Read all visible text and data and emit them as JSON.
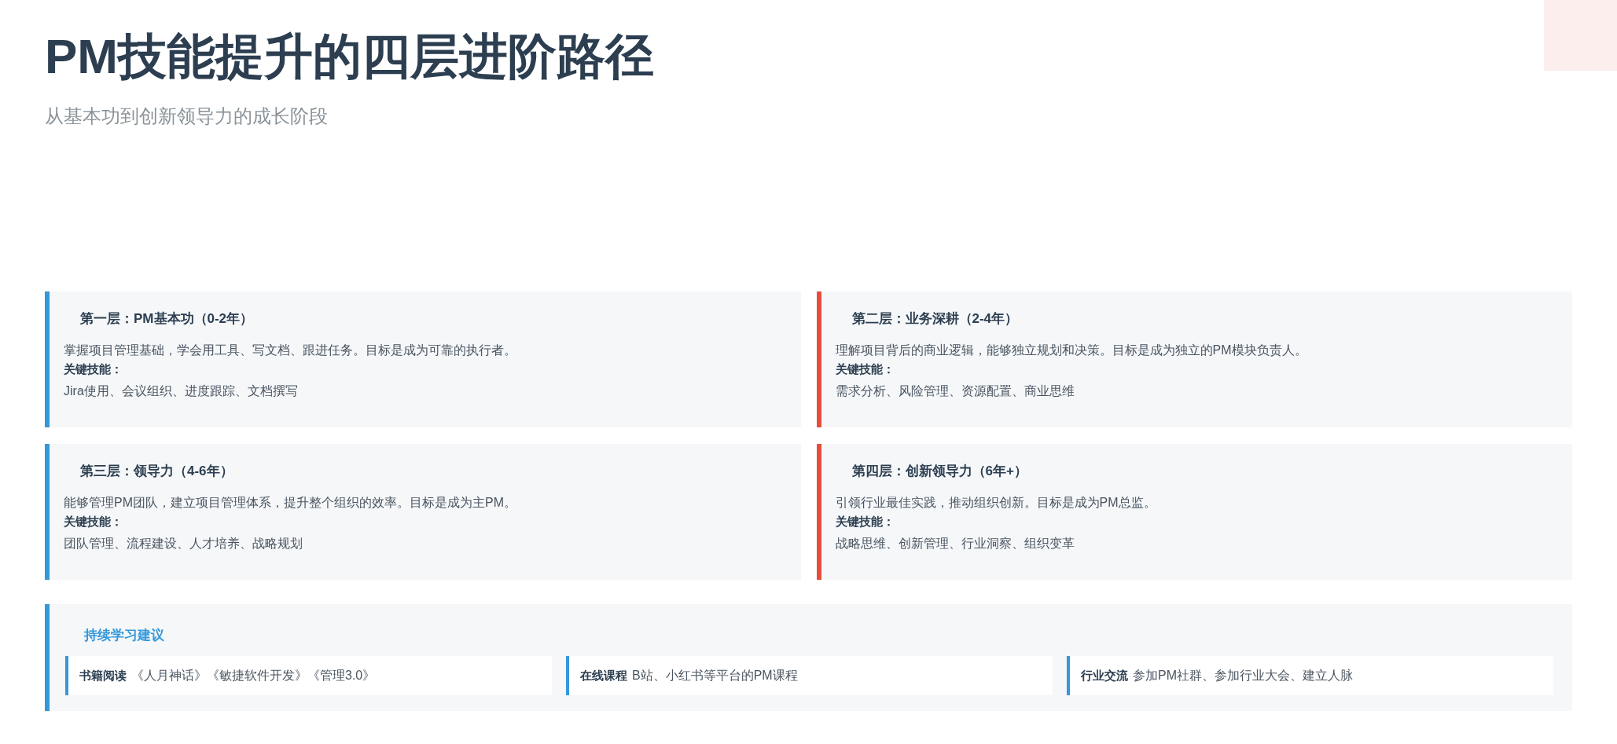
{
  "title": "PM技能提升的四层进阶路径",
  "subtitle": "从基本功到创新领导力的成长阶段",
  "levels": [
    {
      "heading": "第一层：**PM基本功（0-2年）**",
      "description": "掌握项目管理基础，学会用工具、写文档、跟进任务。目标是成为可靠的执行者。",
      "skills_label": "关键技能：",
      "skills": "Jira使用、会议组织、进度跟踪、文档撰写",
      "color": "#3498db"
    },
    {
      "heading": "第二层：**业务深耕（2-4年）**",
      "description": "理解项目背后的商业逻辑，能够独立规划和决策。目标是成为独立的PM模块负责人。",
      "skills_label": "关键技能：",
      "skills": "需求分析、风险管理、资源配置、商业思维",
      "color": "#e74c3c"
    },
    {
      "heading": "第三层：**领导力（4-6年）**",
      "description": "能够管理PM团队，建立项目管理体系，提升整个组织的效率。目标是成为主PM。",
      "skills_label": "关键技能：",
      "skills": "团队管理、流程建设、人才培养、战略规划",
      "color": "#3498db"
    },
    {
      "heading": "第四层：**创新领导力（6年+）**",
      "description": "引领行业最佳实践，推动组织创新。目标是成为PM总监。",
      "skills_label": "关键技能：",
      "skills": "战略思维、创新管理、行业洞察、组织变革",
      "color": "#e74c3c"
    }
  ],
  "learning": {
    "title": "持续学习建议",
    "items": [
      {
        "label": "书籍阅读",
        "text": "《人月神话》《敏捷软件开发》《管理3.0》"
      },
      {
        "label": "在线课程",
        "text": "B站、小红书等平台的PM课程"
      },
      {
        "label": "行业交流",
        "text": "参加PM社群、参加行业大会、建立人脉"
      }
    ]
  }
}
